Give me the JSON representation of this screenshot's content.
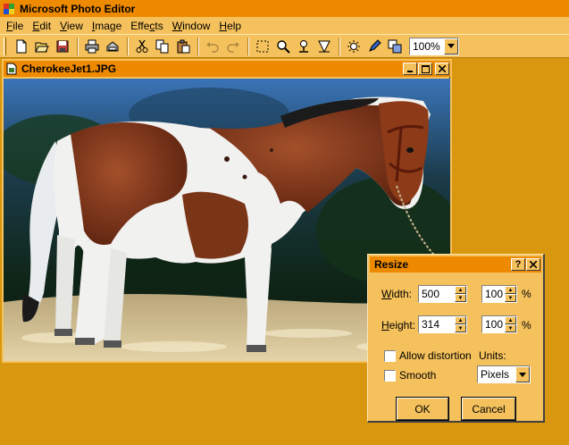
{
  "app": {
    "title": "Microsoft Photo Editor"
  },
  "menu": [
    {
      "label": "File",
      "key": "F"
    },
    {
      "label": "Edit",
      "key": "E"
    },
    {
      "label": "View",
      "key": "V"
    },
    {
      "label": "Image",
      "key": "I"
    },
    {
      "label": "Effects",
      "key": "c"
    },
    {
      "label": "Window",
      "key": "W"
    },
    {
      "label": "Help",
      "key": "H"
    }
  ],
  "toolbar": {
    "icons": [
      "new-icon",
      "open-icon",
      "save-icon",
      "print-icon",
      "scan-icon",
      "cut-icon",
      "copy-icon",
      "paste-icon",
      "undo-icon",
      "redo-icon",
      "select-icon",
      "zoom-icon",
      "smudge-icon",
      "transparency-icon",
      "sharpen-icon",
      "pen-icon",
      "resize-icon"
    ],
    "zoom": "100%"
  },
  "document": {
    "title": "CherokeeJet1.JPG"
  },
  "dialog": {
    "title": "Resize",
    "width_label": "Width:",
    "width_key": "W",
    "width_value": "500",
    "width_pct": "100",
    "height_label": "Height:",
    "height_key": "H",
    "height_value": "314",
    "height_pct": "100",
    "pct_symbol": "%",
    "allow_distortion_label": "Allow distortion",
    "allow_distortion_checked": false,
    "smooth_label": "Smooth",
    "smooth_checked": false,
    "units_label": "Units:",
    "units_value": "Pixels",
    "ok_label": "OK",
    "cancel_label": "Cancel"
  },
  "colors": {
    "title_bar": "#ee8a00",
    "face": "#f5c15c",
    "desktop": "#d9960f"
  }
}
